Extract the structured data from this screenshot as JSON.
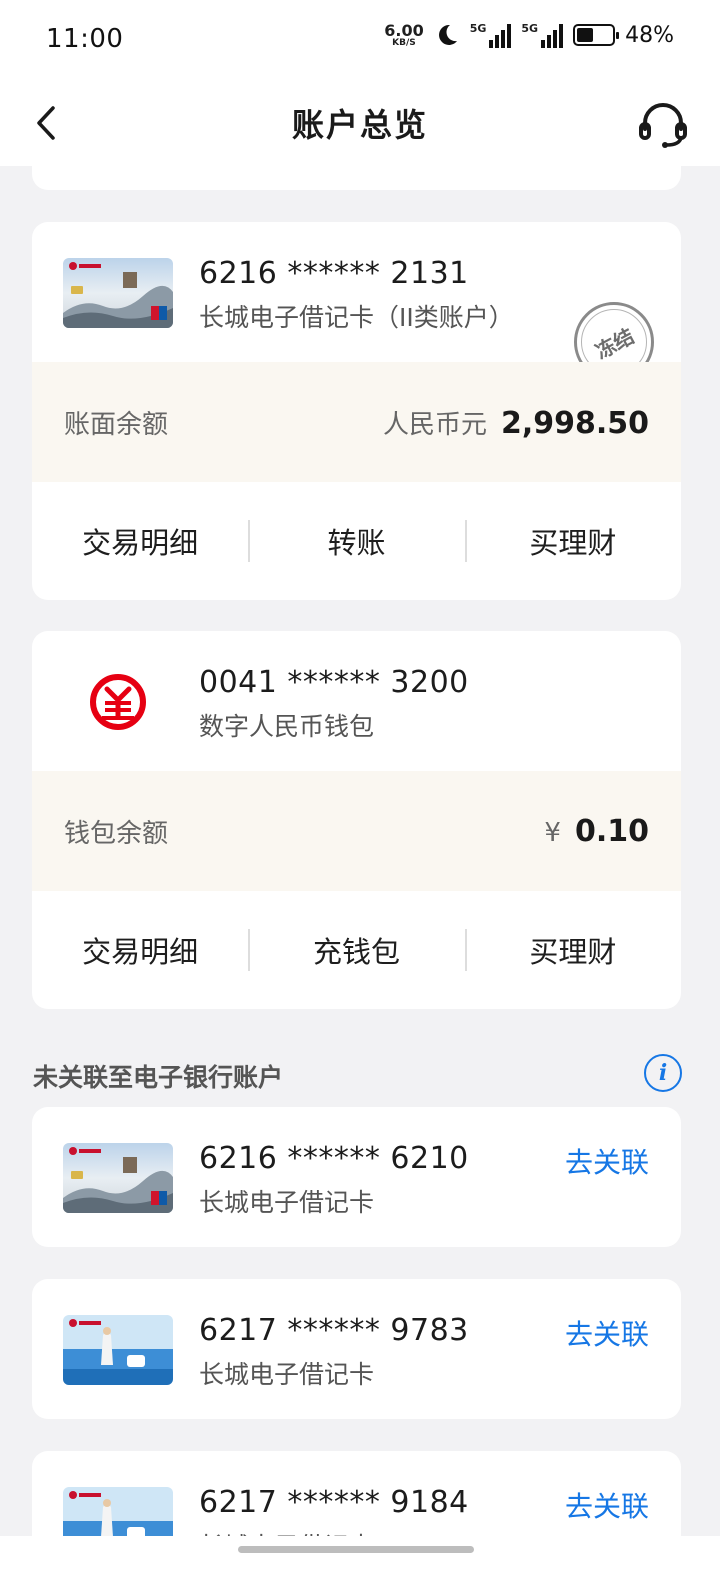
{
  "status_bar": {
    "time": "11:00",
    "net_speed_value": "6.00",
    "net_speed_unit": "KB/S",
    "signal1_label": "5G",
    "signal2_label": "5G",
    "battery_pct": "48%",
    "battery_level": 0.48
  },
  "header": {
    "title": "账户总览",
    "back_icon": "chevron-left-icon",
    "service_icon": "headset-icon"
  },
  "accounts": [
    {
      "number": "6216 ****** 2131",
      "type": "长城电子借记卡（II类账户）",
      "stamp": "冻结",
      "balance_label": "账面余额",
      "currency": "人民币元",
      "amount": "2,998.50",
      "actions": [
        "交易明细",
        "转账",
        "买理财"
      ]
    },
    {
      "number": "0041 ****** 3200",
      "type": "数字人民币钱包",
      "balance_label": "钱包余额",
      "currency": "¥",
      "amount": "0.10",
      "actions": [
        "交易明细",
        "充钱包",
        "买理财"
      ]
    }
  ],
  "unlinked_section": {
    "title": "未关联至电子银行账户",
    "info_icon": "info-icon",
    "items": [
      {
        "number": "6216 ****** 6210",
        "type": "长城电子借记卡",
        "action": "去关联"
      },
      {
        "number": "6217 ****** 9783",
        "type": "长城电子借记卡",
        "action": "去关联"
      },
      {
        "number": "6217 ****** 9184",
        "type": "长城电子借记卡",
        "action": "去关联"
      }
    ]
  },
  "colors": {
    "accent_blue": "#1677e5",
    "balance_bg": "#faf7f1",
    "ecny_red": "#e60012"
  }
}
